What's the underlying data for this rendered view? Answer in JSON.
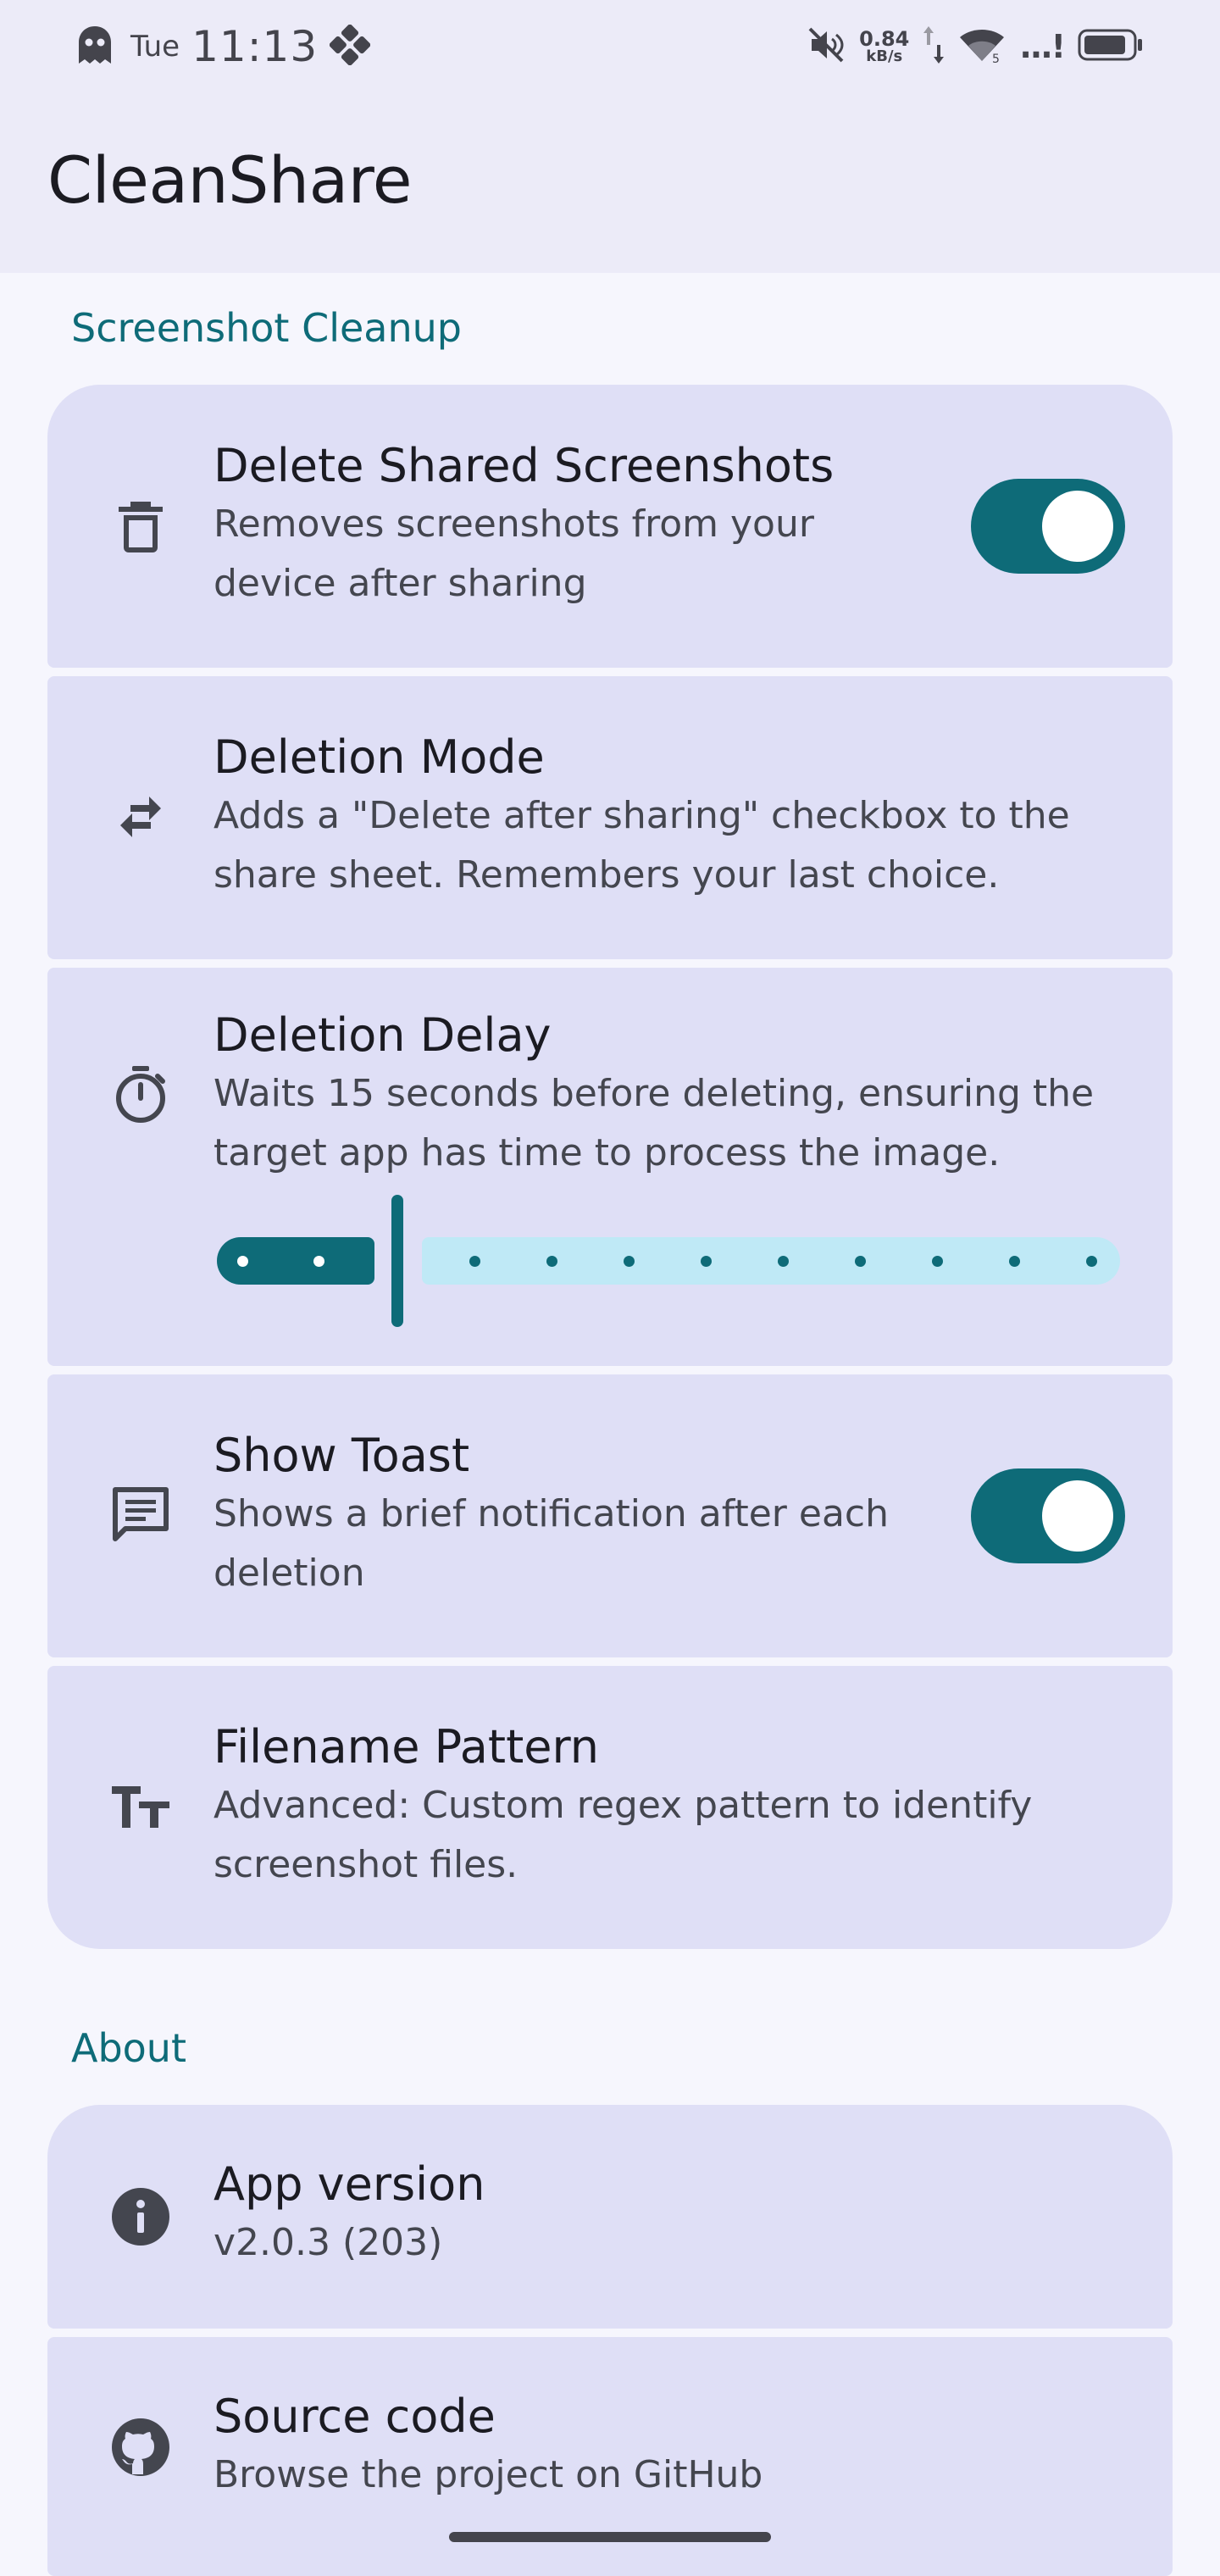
{
  "status_bar": {
    "day": "Tue",
    "time": "11:13",
    "net_speed_value": "0.84",
    "net_speed_unit": "kB/s",
    "signal_text": "...!"
  },
  "app_bar": {
    "title": "CleanShare"
  },
  "sections": {
    "cleanup": {
      "title": "Screenshot Cleanup"
    },
    "about": {
      "title": "About"
    }
  },
  "settings": {
    "delete_shared": {
      "icon": "trash-icon",
      "title": "Delete Shared Screenshots",
      "desc_line1": "Removes screenshots from your",
      "desc_line2": "device after sharing",
      "enabled": true
    },
    "deletion_mode": {
      "icon": "swap-arrows-icon",
      "title": "Deletion Mode",
      "desc_line1": "Adds a \"Delete after sharing\" checkbox to the",
      "desc_line2": "share sheet. Remembers your last choice."
    },
    "deletion_delay": {
      "icon": "timer-icon",
      "title": "Deletion Delay",
      "desc_line1": "Waits 15 seconds before deleting, ensuring the",
      "desc_line2": "target app has time to process the image.",
      "slider_step": 2,
      "slider_steps_total": 12
    },
    "show_toast": {
      "icon": "message-icon",
      "title": "Show Toast",
      "desc_line1": "Shows a brief notification after each",
      "desc_line2": "deletion",
      "enabled": true
    },
    "filename_pattern": {
      "icon": "text-format-icon",
      "title": "Filename Pattern",
      "desc_line1": "Advanced: Custom regex pattern to identify",
      "desc_line2": "screenshot files."
    }
  },
  "about": {
    "app_version": {
      "icon": "info-icon",
      "title": "App version",
      "value": "v2.0.3 (203)"
    },
    "source_code": {
      "icon": "github-icon",
      "title": "Source code",
      "desc": "Browse the project on GitHub"
    }
  },
  "colors": {
    "accent": "#0e6b78",
    "card": "#dfdff6",
    "slider_track": "#bfe9f6",
    "app_bar": "#ecebf8",
    "background": "#f6f6fd"
  }
}
